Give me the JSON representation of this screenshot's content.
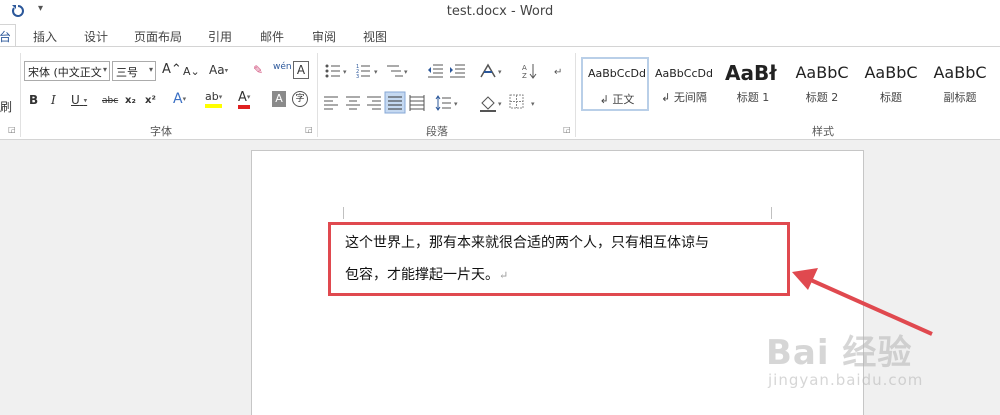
{
  "window": {
    "title": "test.docx - Word"
  },
  "quick_access": {
    "undo_icon": "undo-icon",
    "more": "₹"
  },
  "tabs": [
    {
      "label": "台",
      "active": true
    },
    {
      "label": "插入"
    },
    {
      "label": "设计"
    },
    {
      "label": "页面布局"
    },
    {
      "label": "引用"
    },
    {
      "label": "邮件"
    },
    {
      "label": "审阅"
    },
    {
      "label": "视图"
    }
  ],
  "clipboard": {
    "partial_label": "刷"
  },
  "font": {
    "name": "宋体 (中文正文",
    "size": "三号",
    "grow": "A",
    "shrink": "A",
    "change_case": "Aa",
    "clear_format": "✎",
    "phonetic": "wén",
    "border_char": "A",
    "bold": "B",
    "italic": "I",
    "underline": "U",
    "strike": "abc",
    "subscript": "x₂",
    "superscript": "x²",
    "effects": "A",
    "highlight": "ab",
    "font_color": "A",
    "shading": "A",
    "enclose": "字",
    "group_label": "字体"
  },
  "paragraph": {
    "group_label": "段落"
  },
  "styles": {
    "group_label": "样式",
    "items": [
      {
        "sample": "AaBbCcDd",
        "name": "↲ 正文",
        "selected": true
      },
      {
        "sample": "AaBbCcDd",
        "name": "↲ 无间隔"
      },
      {
        "sample": "AaBł",
        "name": "标题 1"
      },
      {
        "sample": "AaBbC",
        "name": "标题 2"
      },
      {
        "sample": "AaBbC",
        "name": "标题"
      },
      {
        "sample": "AaBbC",
        "name": "副标题"
      }
    ]
  },
  "document": {
    "line1": "这个世界上，那有本来就很合适的两个人，只有相互体谅与",
    "line2": "包容，才能撑起一片天。",
    "para_mark": "↵"
  },
  "watermark": {
    "main": "Bai 经验",
    "sub": "jingyan.baidu.com"
  },
  "colors": {
    "accent": "#2b579a",
    "highlight_border": "#e0494f",
    "highlight_yellow": "#ffff00",
    "font_red": "#e02020"
  }
}
